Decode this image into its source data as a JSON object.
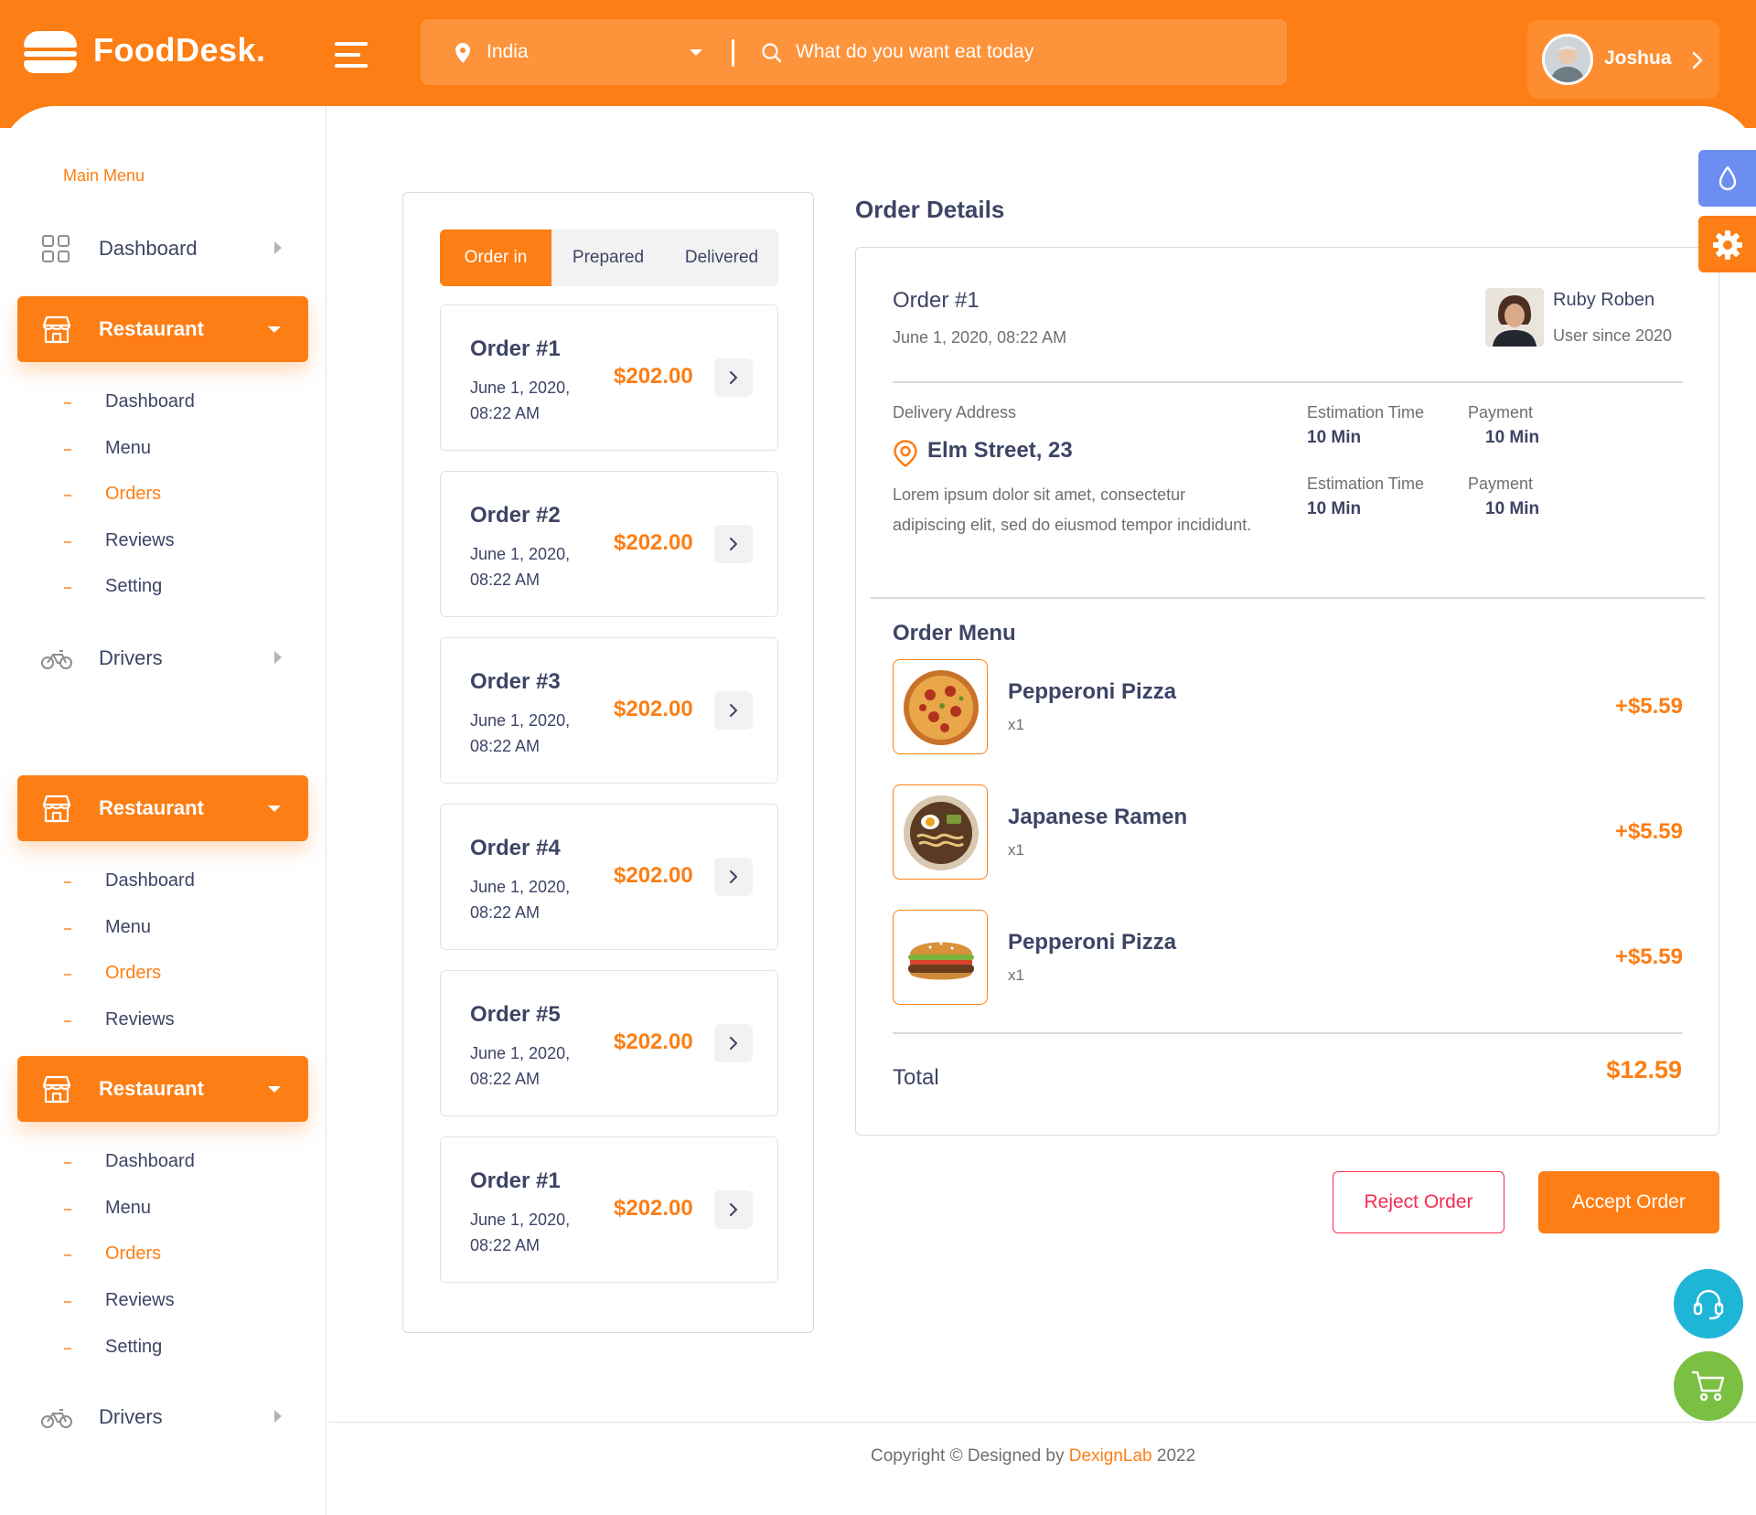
{
  "header": {
    "brand": "FoodDesk.",
    "location": "India",
    "search_placeholder": "What do you want eat today",
    "user_name": "Joshua"
  },
  "sidebar": {
    "section_title": "Main Menu",
    "dashboard": "Dashboard",
    "groups": [
      {
        "label": "Restaurant",
        "subitems": [
          "Dashboard",
          "Menu",
          "Orders",
          "Reviews",
          "Setting"
        ],
        "active_sub": "Orders"
      },
      {
        "label": "Restaurant",
        "subitems": [
          "Dashboard",
          "Menu",
          "Orders",
          "Reviews"
        ],
        "active_sub": "Orders"
      },
      {
        "label": "Restaurant",
        "subitems": [
          "Dashboard",
          "Menu",
          "Orders",
          "Reviews",
          "Setting"
        ],
        "active_sub": "Orders"
      }
    ],
    "drivers": "Drivers"
  },
  "orders": {
    "tabs": [
      "Order in",
      "Prepared",
      "Delivered"
    ],
    "active_tab": "Order in",
    "list": [
      {
        "title": "Order #1",
        "date": "June 1, 2020, 08:22 AM",
        "price": "$202.00"
      },
      {
        "title": "Order #2",
        "date": "June 1, 2020, 08:22 AM",
        "price": "$202.00"
      },
      {
        "title": "Order #3",
        "date": "June 1, 2020, 08:22 AM",
        "price": "$202.00"
      },
      {
        "title": "Order #4",
        "date": "June 1, 2020, 08:22 AM",
        "price": "$202.00"
      },
      {
        "title": "Order #5",
        "date": "June 1, 2020, 08:22 AM",
        "price": "$202.00"
      },
      {
        "title": "Order #1",
        "date": "June 1, 2020, 08:22 AM",
        "price": "$202.00"
      }
    ]
  },
  "details": {
    "heading": "Order Details",
    "order_id": "Order #1",
    "order_date": "June 1, 2020, 08:22 AM",
    "customer_name": "Ruby Roben",
    "customer_since": "User since 2020",
    "delivery_label": "Delivery Address",
    "street": "Elm Street, 23",
    "description": "Lorem ipsum dolor sit amet, consectetur adipiscing elit, sed do eiusmod tempor incididunt.",
    "stats": [
      {
        "label": "Estimation Time",
        "value": "10 Min"
      },
      {
        "label": "Payment",
        "value": "10 Min"
      },
      {
        "label": "Estimation Time",
        "value": "10 Min"
      },
      {
        "label": "Payment",
        "value": "10 Min"
      }
    ],
    "menu_title": "Order Menu",
    "items": [
      {
        "name": "Pepperoni Pizza",
        "qty": "x1",
        "price": "+$5.59",
        "image": "pizza-image"
      },
      {
        "name": "Japanese Ramen",
        "qty": "x1",
        "price": "+$5.59",
        "image": "ramen-image"
      },
      {
        "name": "Pepperoni Pizza",
        "qty": "x1",
        "price": "+$5.59",
        "image": "burger-image"
      }
    ],
    "total_label": "Total",
    "total_value": "$12.59",
    "reject_label": "Reject Order",
    "accept_label": "Accept Order"
  },
  "footer": {
    "prefix": "Copyright © Designed by ",
    "link": "DexignLab",
    "suffix": " 2022"
  },
  "colors": {
    "accent": "#fd7e14",
    "reject": "#f72b50",
    "theme_button": "#6c8ef3",
    "support_button": "#1fb5d6",
    "cart_button": "#7bc043"
  },
  "icons": [
    "burger-logo-icon",
    "hamburger-icon",
    "location-pin-icon",
    "search-icon",
    "chevron-right-icon",
    "grid-icon",
    "store-icon",
    "bicycle-icon",
    "droplet-icon",
    "gear-icon",
    "headset-icon",
    "cart-icon"
  ]
}
